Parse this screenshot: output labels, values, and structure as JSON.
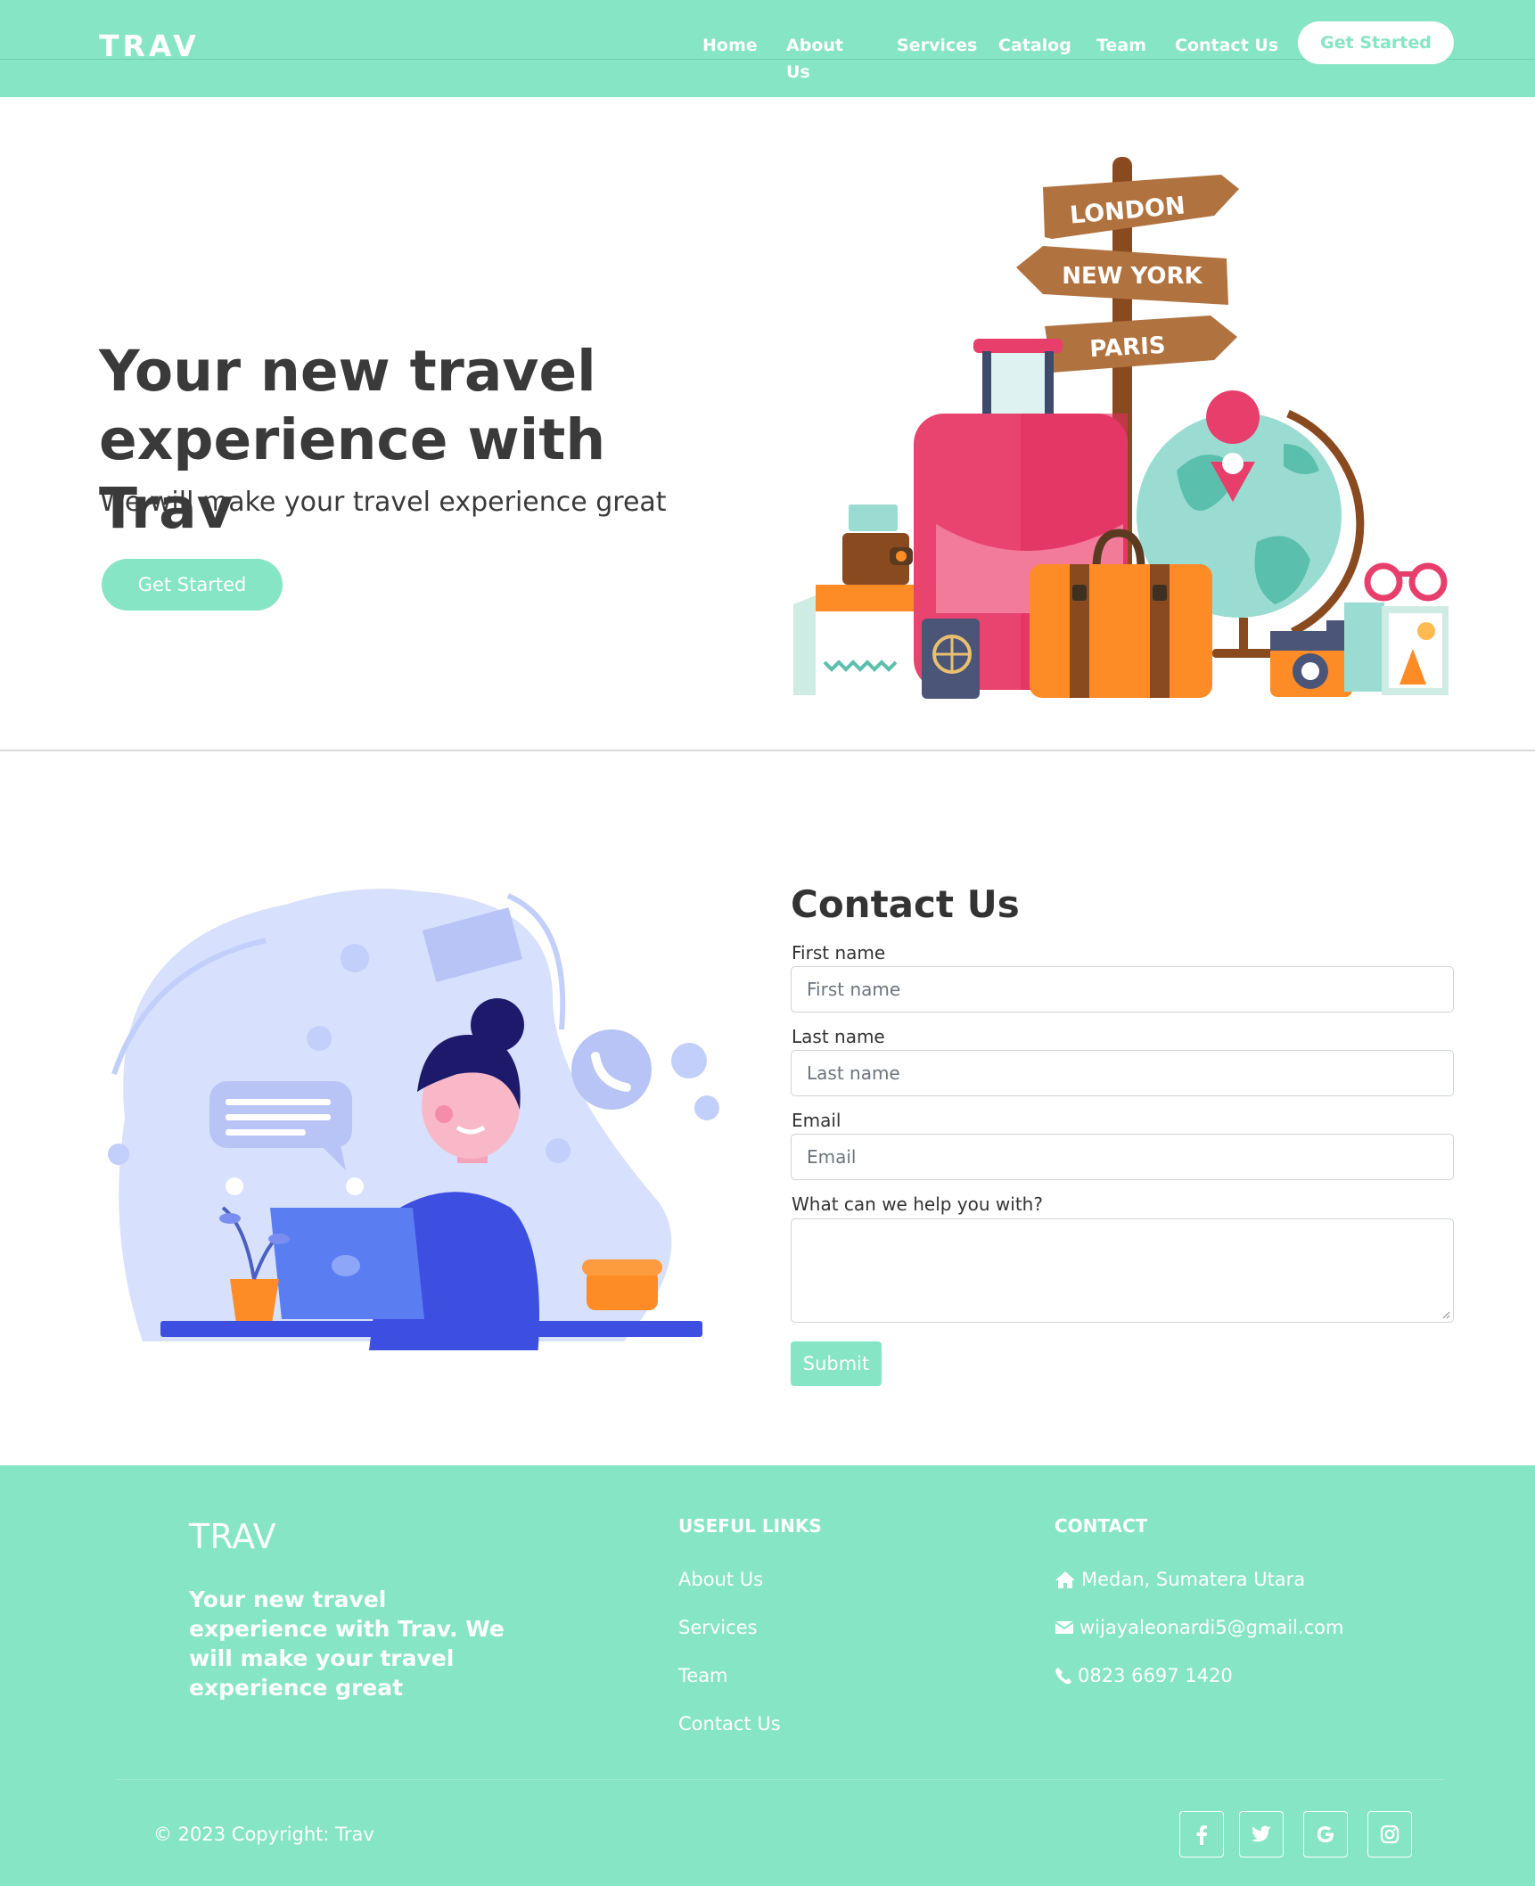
{
  "nav": {
    "brand": "TRAV",
    "links": [
      "Home",
      "About Us",
      "Services",
      "Catalog",
      "Team",
      "Contact Us"
    ],
    "cta": "Get Started"
  },
  "hero": {
    "title": "Your new travel experience with Trav",
    "subtitle": "We will make your travel experience great",
    "cta": "Get Started",
    "signs": [
      "LONDON",
      "NEW YORK",
      "PARIS"
    ]
  },
  "contact": {
    "title": "Contact Us",
    "fields": [
      {
        "label": "First name",
        "placeholder": "First name"
      },
      {
        "label": "Last name",
        "placeholder": "Last name"
      },
      {
        "label": "Email",
        "placeholder": "Email"
      }
    ],
    "message_label": "What can we help you with?",
    "submit": "Submit"
  },
  "footer": {
    "brand": "TRAV",
    "tagline": "Your new travel experience with Trav. We will make your travel experience great",
    "links_heading": "USEFUL LINKS",
    "links": [
      "About Us",
      "Services",
      "Team",
      "Contact Us"
    ],
    "contact_heading": "CONTACT",
    "address": "Medan, Sumatera Utara",
    "email": "wijayaleonardi5@gmail.com",
    "phone": "0823 6697 1420",
    "copyright": "© 2023 Copyright: Trav",
    "social": [
      "facebook-icon",
      "twitter-icon",
      "google-icon",
      "instagram-icon"
    ]
  },
  "colors": {
    "accent": "#86e5c4",
    "heading": "#3a3a3a"
  }
}
